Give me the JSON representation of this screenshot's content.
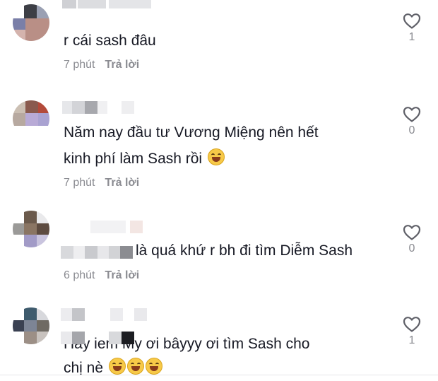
{
  "comments": [
    {
      "text": "r cái sash đâu",
      "time": "7 phút",
      "reply": "Trả lời",
      "likes": "1"
    },
    {
      "text_line1": "Năm nay đầu tư Vương Miệng nên hết",
      "text_line2": "kinh phí làm Sash rồi",
      "time": "7 phút",
      "reply": "Trả lời",
      "likes": "0"
    },
    {
      "text": "là quá khứ r bh đi tìm Diễm Sash",
      "time": "6 phút",
      "reply": "Trả lời",
      "likes": "0"
    },
    {
      "text_line1": "Hay iem My ơi bâyyy ơi tìm Sash cho",
      "text_line2": "chị nè",
      "likes": "1"
    }
  ],
  "icons": {
    "like": "heart-outline-icon",
    "emoji": "grinning-squinting-face-icon"
  },
  "colors": {
    "text": "#161823",
    "muted": "#8a8b91",
    "background": "#ffffff"
  }
}
